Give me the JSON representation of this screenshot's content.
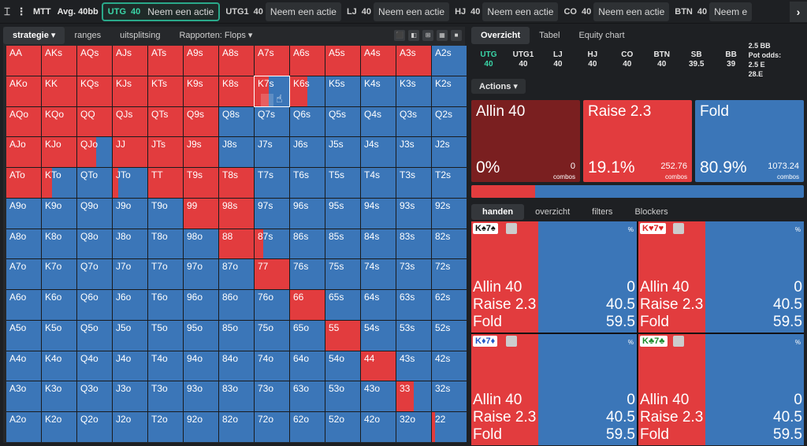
{
  "topbar": {
    "mode_label": "MTT",
    "stack": "Avg. 40bb",
    "positions": [
      {
        "pos": "UTG",
        "stack": "40",
        "action": "Neem een actie",
        "selected": true
      },
      {
        "pos": "UTG1",
        "stack": "40",
        "action": "Neem een actie",
        "selected": false
      },
      {
        "pos": "LJ",
        "stack": "40",
        "action": "Neem een actie",
        "selected": false
      },
      {
        "pos": "HJ",
        "stack": "40",
        "action": "Neem een actie",
        "selected": false
      },
      {
        "pos": "CO",
        "stack": "40",
        "action": "Neem een actie",
        "selected": false
      },
      {
        "pos": "BTN",
        "stack": "40",
        "action": "Neem e",
        "selected": false
      }
    ]
  },
  "left_tabs": [
    "strategie ▾",
    "ranges",
    "uitsplitsing",
    "Rapporten: Flops ▾"
  ],
  "grid": [
    [
      "AA",
      1
    ],
    [
      "AKs",
      1
    ],
    [
      "AQs",
      1
    ],
    [
      "AJs",
      1
    ],
    [
      "ATs",
      1
    ],
    [
      "A9s",
      1
    ],
    [
      "A8s",
      1
    ],
    [
      "A7s",
      1
    ],
    [
      "A6s",
      1
    ],
    [
      "A5s",
      1
    ],
    [
      "A4s",
      1
    ],
    [
      "A3s",
      1
    ],
    [
      "A2s",
      0
    ],
    [
      "AKo",
      1
    ],
    [
      "KK",
      1
    ],
    [
      "KQs",
      1
    ],
    [
      "KJs",
      1
    ],
    [
      "KTs",
      1
    ],
    [
      "K9s",
      1
    ],
    [
      "K8s",
      1
    ],
    [
      "K7s",
      0.4
    ],
    [
      "K6s",
      0.5
    ],
    [
      "K5s",
      0
    ],
    [
      "K4s",
      0
    ],
    [
      "K3s",
      0
    ],
    [
      "K2s",
      0
    ],
    [
      "AQo",
      1
    ],
    [
      "KQo",
      1
    ],
    [
      "QQ",
      1
    ],
    [
      "QJs",
      1
    ],
    [
      "QTs",
      1
    ],
    [
      "Q9s",
      1
    ],
    [
      "Q8s",
      0
    ],
    [
      "Q7s",
      0
    ],
    [
      "Q6s",
      0
    ],
    [
      "Q5s",
      0
    ],
    [
      "Q4s",
      0
    ],
    [
      "Q3s",
      0
    ],
    [
      "Q2s",
      0
    ],
    [
      "AJo",
      1
    ],
    [
      "KJo",
      1
    ],
    [
      "QJo",
      0.55
    ],
    [
      "JJ",
      1
    ],
    [
      "JTs",
      1
    ],
    [
      "J9s",
      1
    ],
    [
      "J8s",
      0
    ],
    [
      "J7s",
      0
    ],
    [
      "J6s",
      0
    ],
    [
      "J5s",
      0
    ],
    [
      "J4s",
      0
    ],
    [
      "J3s",
      0
    ],
    [
      "J2s",
      0
    ],
    [
      "ATo",
      1
    ],
    [
      "KTo",
      0.3
    ],
    [
      "QTo",
      0
    ],
    [
      "JTo",
      0.15
    ],
    [
      "TT",
      1
    ],
    [
      "T9s",
      1
    ],
    [
      "T8s",
      1
    ],
    [
      "T7s",
      0
    ],
    [
      "T6s",
      0
    ],
    [
      "T5s",
      0
    ],
    [
      "T4s",
      0
    ],
    [
      "T3s",
      0
    ],
    [
      "T2s",
      0
    ],
    [
      "A9o",
      0
    ],
    [
      "K9o",
      0
    ],
    [
      "Q9o",
      0
    ],
    [
      "J9o",
      0
    ],
    [
      "T9o",
      0
    ],
    [
      "99",
      1
    ],
    [
      "98s",
      1
    ],
    [
      "97s",
      0
    ],
    [
      "96s",
      0
    ],
    [
      "95s",
      0
    ],
    [
      "94s",
      0
    ],
    [
      "93s",
      0
    ],
    [
      "92s",
      0
    ],
    [
      "A8o",
      0
    ],
    [
      "K8o",
      0
    ],
    [
      "Q8o",
      0
    ],
    [
      "J8o",
      0
    ],
    [
      "T8o",
      0
    ],
    [
      "98o",
      0
    ],
    [
      "88",
      1
    ],
    [
      "87s",
      0.25
    ],
    [
      "86s",
      0
    ],
    [
      "85s",
      0
    ],
    [
      "84s",
      0
    ],
    [
      "83s",
      0
    ],
    [
      "82s",
      0
    ],
    [
      "A7o",
      0
    ],
    [
      "K7o",
      0
    ],
    [
      "Q7o",
      0
    ],
    [
      "J7o",
      0
    ],
    [
      "T7o",
      0
    ],
    [
      "97o",
      0
    ],
    [
      "87o",
      0
    ],
    [
      "77",
      1
    ],
    [
      "76s",
      0
    ],
    [
      "75s",
      0
    ],
    [
      "74s",
      0
    ],
    [
      "73s",
      0
    ],
    [
      "72s",
      0
    ],
    [
      "A6o",
      0
    ],
    [
      "K6o",
      0
    ],
    [
      "Q6o",
      0
    ],
    [
      "J6o",
      0
    ],
    [
      "T6o",
      0
    ],
    [
      "96o",
      0
    ],
    [
      "86o",
      0
    ],
    [
      "76o",
      0
    ],
    [
      "66",
      1
    ],
    [
      "65s",
      0
    ],
    [
      "64s",
      0
    ],
    [
      "63s",
      0
    ],
    [
      "62s",
      0
    ],
    [
      "A5o",
      0
    ],
    [
      "K5o",
      0
    ],
    [
      "Q5o",
      0
    ],
    [
      "J5o",
      0
    ],
    [
      "T5o",
      0
    ],
    [
      "95o",
      0
    ],
    [
      "85o",
      0
    ],
    [
      "75o",
      0
    ],
    [
      "65o",
      0
    ],
    [
      "55",
      1
    ],
    [
      "54s",
      0
    ],
    [
      "53s",
      0
    ],
    [
      "52s",
      0
    ],
    [
      "A4o",
      0
    ],
    [
      "K4o",
      0
    ],
    [
      "Q4o",
      0
    ],
    [
      "J4o",
      0
    ],
    [
      "T4o",
      0
    ],
    [
      "94o",
      0
    ],
    [
      "84o",
      0
    ],
    [
      "74o",
      0
    ],
    [
      "64o",
      0
    ],
    [
      "54o",
      0
    ],
    [
      "44",
      1
    ],
    [
      "43s",
      0
    ],
    [
      "42s",
      0
    ],
    [
      "A3o",
      0
    ],
    [
      "K3o",
      0
    ],
    [
      "Q3o",
      0
    ],
    [
      "J3o",
      0
    ],
    [
      "T3o",
      0
    ],
    [
      "93o",
      0
    ],
    [
      "83o",
      0
    ],
    [
      "73o",
      0
    ],
    [
      "63o",
      0
    ],
    [
      "53o",
      0
    ],
    [
      "43o",
      0
    ],
    [
      "33",
      0.5
    ],
    [
      "32s",
      0
    ],
    [
      "A2o",
      0
    ],
    [
      "K2o",
      0
    ],
    [
      "Q2o",
      0
    ],
    [
      "J2o",
      0
    ],
    [
      "T2o",
      0
    ],
    [
      "92o",
      0
    ],
    [
      "82o",
      0
    ],
    [
      "72o",
      0
    ],
    [
      "62o",
      0
    ],
    [
      "52o",
      0
    ],
    [
      "42o",
      0
    ],
    [
      "32o",
      0
    ],
    [
      "22",
      0.1
    ]
  ],
  "right_tabs": [
    "Overzicht",
    "Tabel",
    "Equity chart"
  ],
  "positions_summary": [
    {
      "pos": "UTG",
      "val": "40",
      "selected": true
    },
    {
      "pos": "UTG1",
      "val": "40"
    },
    {
      "pos": "LJ",
      "val": "40"
    },
    {
      "pos": "HJ",
      "val": "40"
    },
    {
      "pos": "CO",
      "val": "40"
    },
    {
      "pos": "BTN",
      "val": "40"
    },
    {
      "pos": "SB",
      "val": "39.5"
    },
    {
      "pos": "BB",
      "val": "39"
    }
  ],
  "pot": {
    "main": "2.5 BB",
    "sub": "Pot odds:",
    "extra": "2.5 E",
    "extra2": "28.E"
  },
  "actions_label": "Actions ▾",
  "action_cards": [
    {
      "name": "Allin 40",
      "pct": "0%",
      "combos": "0",
      "combos_label": "combos",
      "color": "#7a1f20"
    },
    {
      "name": "Raise 2.3",
      "pct": "19.1%",
      "combos": "252.76",
      "combos_label": "combos",
      "color": "#e23c3e"
    },
    {
      "name": "Fold",
      "pct": "80.9%",
      "combos": "1073.24",
      "combos_label": "combos",
      "color": "#3b76b8"
    }
  ],
  "bar_raise_frac": 0.191,
  "hand_tabs": [
    "handen",
    "overzicht",
    "filters",
    "Blockers"
  ],
  "hands": [
    {
      "card": "K♠7♠",
      "rows": [
        [
          "Allin 40",
          "0"
        ],
        [
          "Raise 2.3",
          "40.5"
        ],
        [
          "Fold",
          "59.5"
        ]
      ],
      "pct_sign": "%",
      "raise_frac": 0.405
    },
    {
      "card": "K♥7♥",
      "rows": [
        [
          "Allin 40",
          "0"
        ],
        [
          "Raise 2.3",
          "40.5"
        ],
        [
          "Fold",
          "59.5"
        ]
      ],
      "pct_sign": "%",
      "raise_frac": 0.405
    },
    {
      "card": "K♦7♦",
      "rows": [
        [
          "Allin 40",
          "0"
        ],
        [
          "Raise 2.3",
          "40.5"
        ],
        [
          "Fold",
          "59.5"
        ]
      ],
      "pct_sign": "%",
      "raise_frac": 0.405
    },
    {
      "card": "K♣7♣",
      "rows": [
        [
          "Allin 40",
          "0"
        ],
        [
          "Raise 2.3",
          "40.5"
        ],
        [
          "Fold",
          "59.5"
        ]
      ],
      "pct_sign": "%",
      "raise_frac": 0.405
    }
  ]
}
